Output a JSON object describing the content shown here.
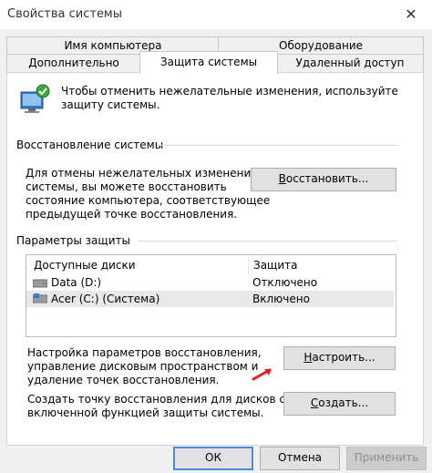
{
  "window": {
    "title": "Свойства системы",
    "close_glyph": "✕"
  },
  "tabs_row1": [
    {
      "label": "Имя компьютера"
    },
    {
      "label": "Оборудование"
    }
  ],
  "tabs_row2": [
    {
      "label": "Дополнительно"
    },
    {
      "label": "Защита системы",
      "active": true
    },
    {
      "label": "Удаленный доступ"
    }
  ],
  "intro": {
    "text1": "Чтобы отменить нежелательные изменения, используйте",
    "text2": "защиту системы.",
    "icon": "system-protection-icon"
  },
  "restore": {
    "heading": "Восстановление системы",
    "desc1": "Для отмены нежелательных изменений",
    "desc2": "системы, вы можете восстановить",
    "desc3": "состояние компьютера, соответствующее",
    "desc4": "предыдущей точке восстановления.",
    "button_pre": "",
    "button_key": "В",
    "button_post": "осстановить..."
  },
  "protection": {
    "heading": "Параметры защиты",
    "columns": [
      "Доступные диски",
      "Защита"
    ],
    "rows": [
      {
        "drive": "Data (D:)",
        "status": "Отключено",
        "icon": "drive-icon"
      },
      {
        "drive": "Acer (C:) (Система)",
        "status": "Включено",
        "icon": "system-drive-icon"
      }
    ]
  },
  "configure": {
    "desc1": "Настройка параметров восстановления,",
    "desc2": "управление дисковым пространством и",
    "desc3": "удаление точек восстановления.",
    "button_pre": "",
    "button_key": "Н",
    "button_post": "астроить..."
  },
  "create": {
    "desc1": "Создать точку восстановления для дисков с",
    "desc2": "включенной функцией защиты системы.",
    "button_pre": "",
    "button_key": "С",
    "button_post": "оздать..."
  },
  "footer": {
    "ok": "ОК",
    "cancel": "Отмена",
    "apply": "Применить"
  },
  "colors": {
    "accent": "#4a8ad8",
    "arrow": "#e3211c"
  }
}
